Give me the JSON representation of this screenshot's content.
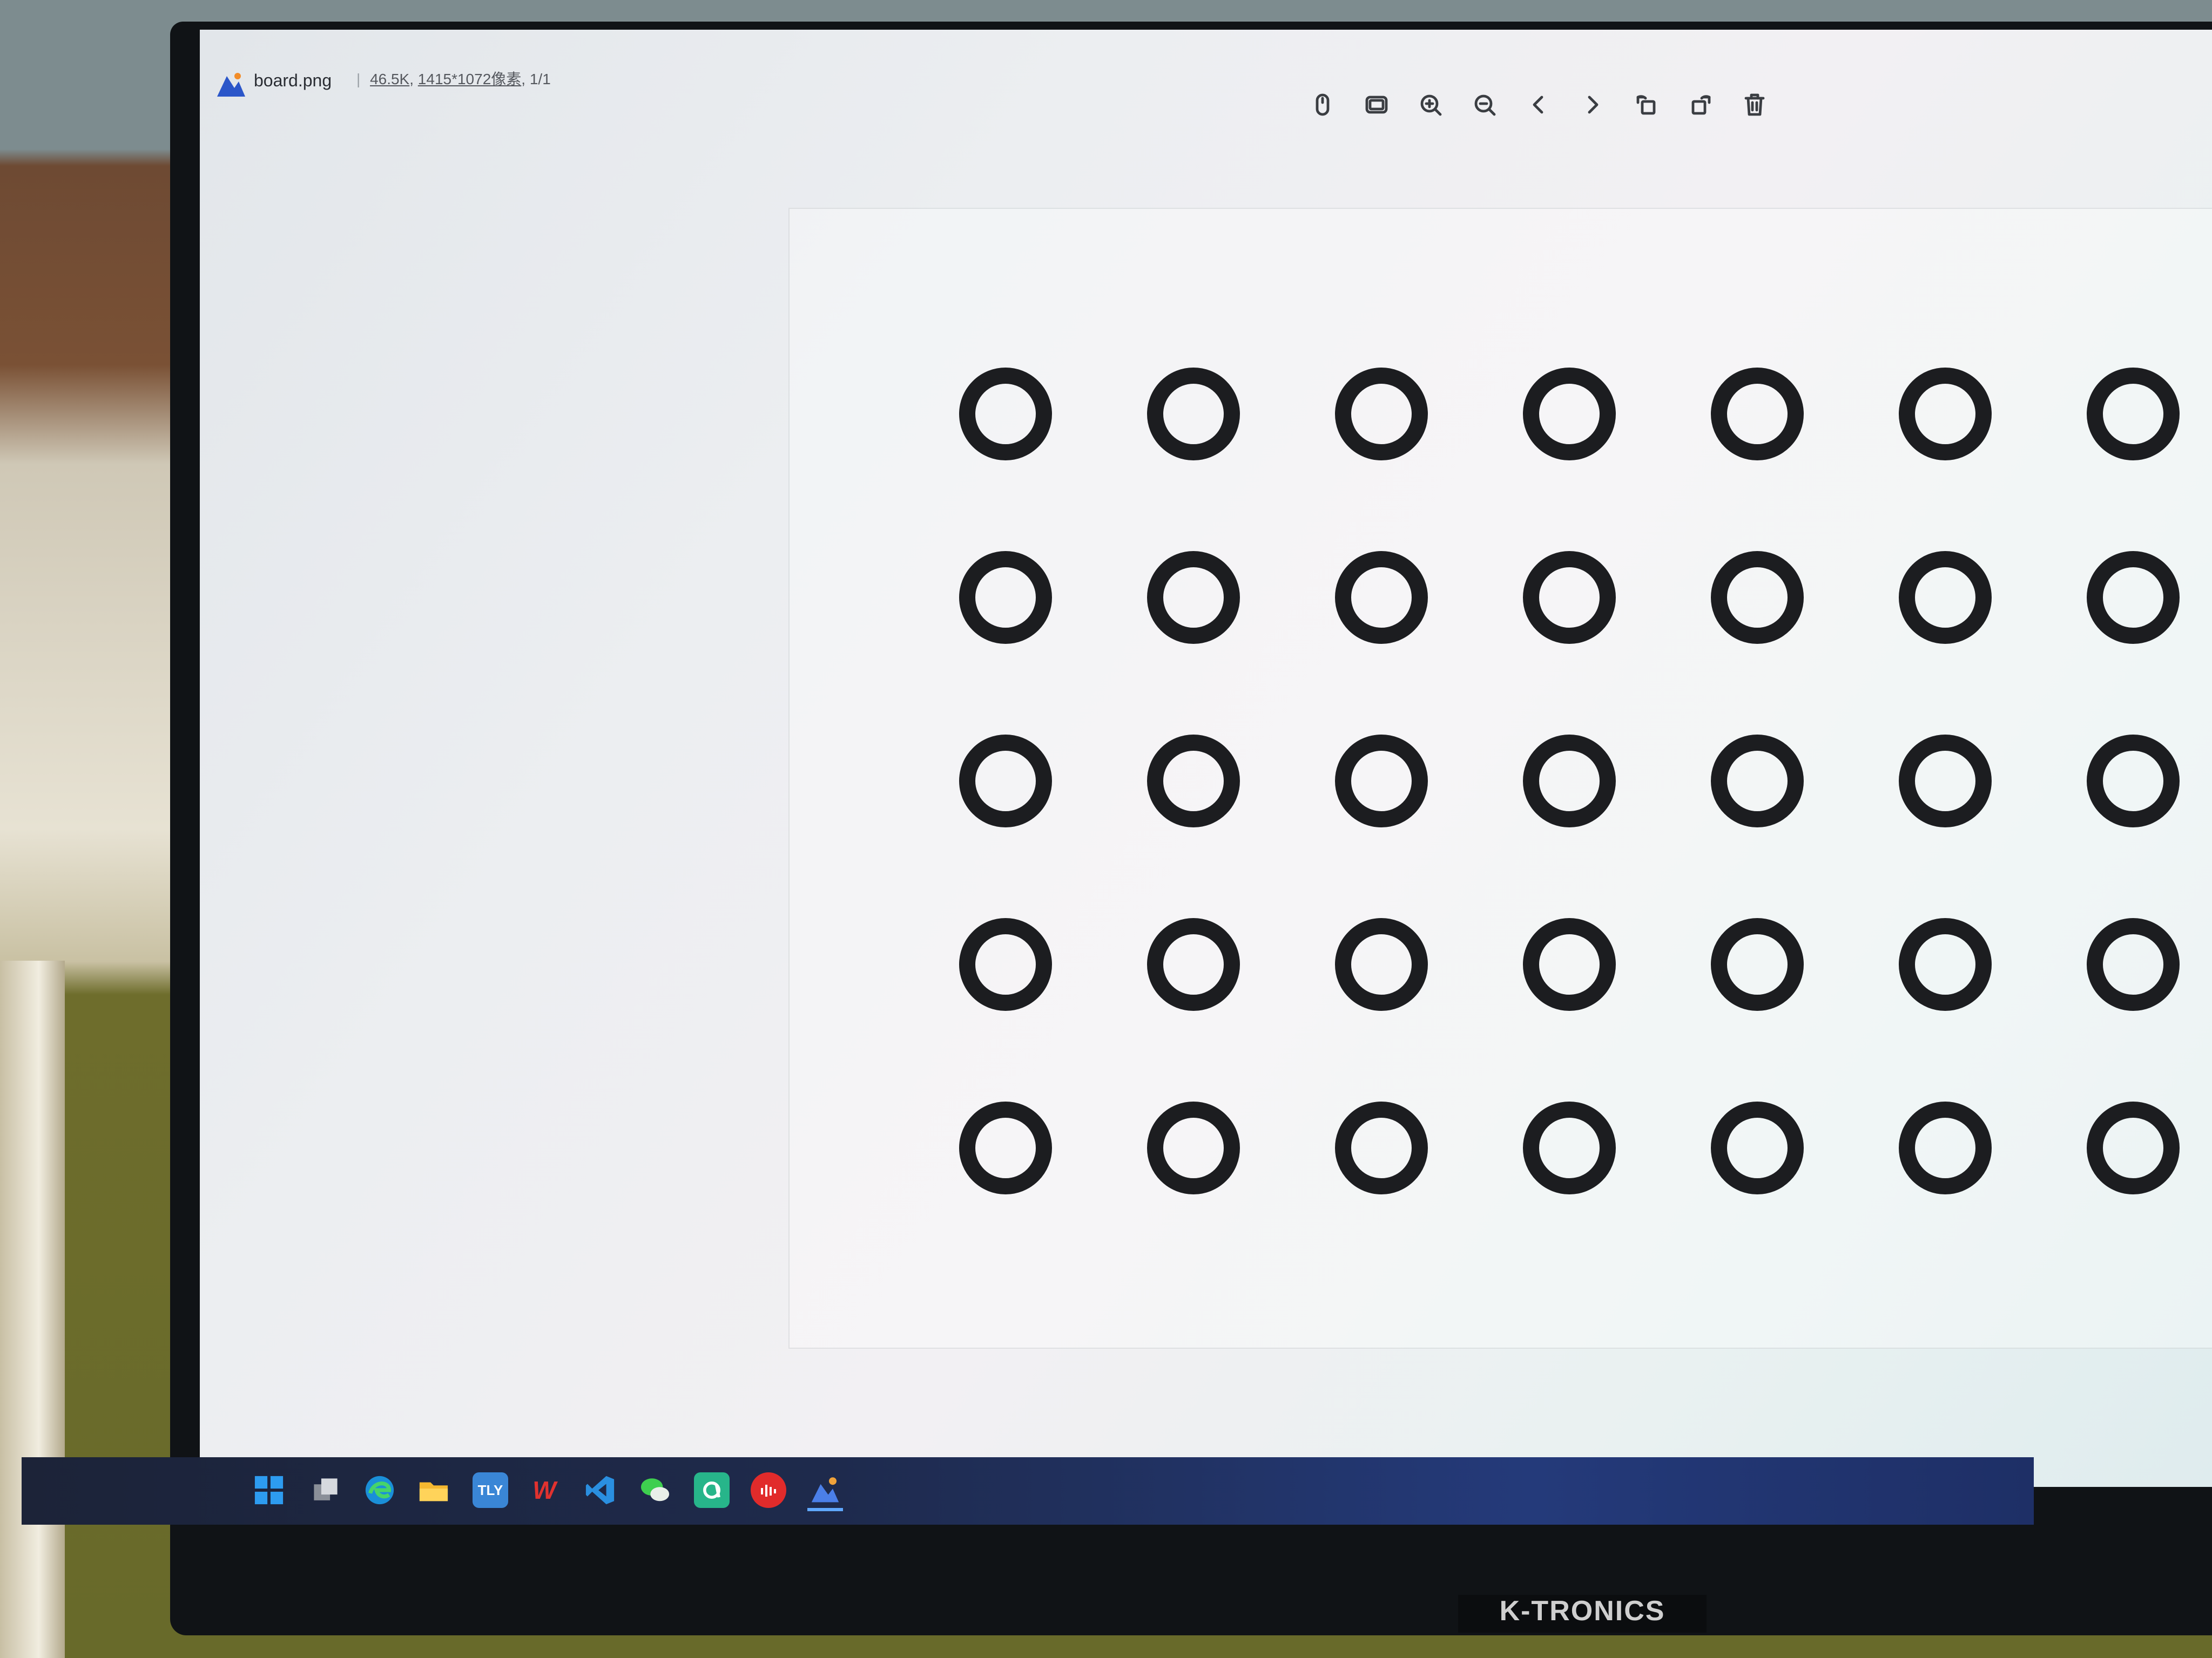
{
  "window": {
    "file_name": "board.png",
    "file_size": "46.5K",
    "dimensions": "1415*1072像素",
    "page_counter": "1/1"
  },
  "toolbar": {
    "buttons": [
      {
        "icon": "mouse-icon"
      },
      {
        "icon": "fit-screen-icon"
      },
      {
        "icon": "zoom-in-icon"
      },
      {
        "icon": "zoom-out-icon"
      },
      {
        "icon": "previous-icon"
      },
      {
        "icon": "next-icon"
      },
      {
        "icon": "rotate-left-icon"
      },
      {
        "icon": "rotate-right-icon"
      },
      {
        "icon": "delete-icon"
      }
    ]
  },
  "board": {
    "rows": 5,
    "columns": 7,
    "pattern": "asymmetric ring grid"
  },
  "taskbar": {
    "apps": [
      {
        "icon": "windows-start-icon"
      },
      {
        "icon": "task-view-icon"
      },
      {
        "icon": "edge-browser-icon"
      },
      {
        "icon": "file-explorer-icon"
      },
      {
        "icon": "tly-app-icon",
        "label": "TLY"
      },
      {
        "icon": "wps-office-icon",
        "label": "W"
      },
      {
        "icon": "vscode-icon"
      },
      {
        "icon": "wechat-icon"
      },
      {
        "icon": "green-app-icon"
      },
      {
        "icon": "red-audio-app-icon"
      },
      {
        "icon": "image-viewer-icon"
      }
    ]
  },
  "monitor": {
    "brand": "K-TRONICS"
  }
}
